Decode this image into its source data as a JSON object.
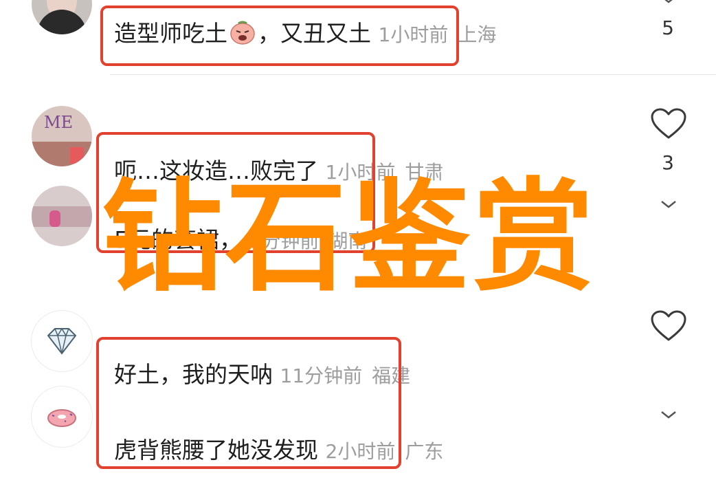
{
  "comments": [
    {
      "text": "造型师吃土",
      "emoji": "pout-face",
      "text2": "，又丑又土",
      "time": "1小时前",
      "location": "上海",
      "likes": "5"
    },
    {
      "text": "呃…这妆造…败完了",
      "time": "1小时前",
      "location": "甘肃",
      "likes": "3"
    },
    {
      "text": "5元的套裙，",
      "time": "9分钟前",
      "location": "湖南"
    },
    {
      "text": "好土，我的天呐",
      "time": "11分钟前",
      "location": "福建"
    },
    {
      "text": "虎背熊腰了她没发现",
      "time": "2小时前",
      "location": "广东"
    }
  ],
  "overlay": {
    "watermark": "钻石鉴赏"
  },
  "colors": {
    "highlight": "#e3412f",
    "watermark": "#ff8a00",
    "meta": "#9d9d9d"
  },
  "icons": {
    "like": "heart-outline-icon",
    "expand": "chevron-down-icon"
  }
}
